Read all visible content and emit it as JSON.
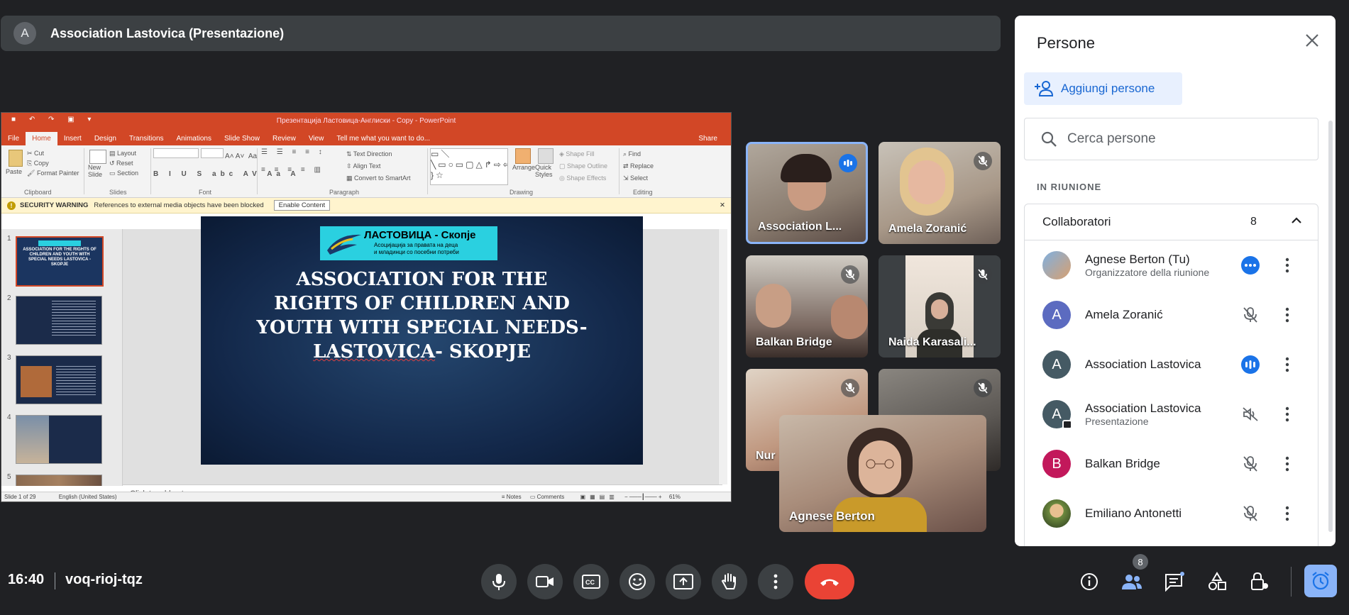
{
  "presenter_bar": {
    "avatar": "A",
    "title": "Association Lastovica (Presentazione)"
  },
  "ppt": {
    "window_title": "Презентација Ластовица-Англиски - Copy - PowerPoint",
    "tabs": [
      "File",
      "Home",
      "Insert",
      "Design",
      "Transitions",
      "Animations",
      "Slide Show",
      "Review",
      "View",
      "Tell me what you want to do..."
    ],
    "share": "Share",
    "ribbon": {
      "paste": "Paste",
      "cut": "Cut",
      "copy": "Copy",
      "format_painter": "Format Painter",
      "clipboard": "Clipboard",
      "new_slide": "New Slide",
      "layout": "Layout",
      "reset": "Reset",
      "section": "Section",
      "slides": "Slides",
      "font": "Font",
      "text_direction": "Text Direction",
      "align_text": "Align Text",
      "convert_smartart": "Convert to SmartArt",
      "paragraph": "Paragraph",
      "arrange": "Arrange",
      "quick_styles": "Quick Styles",
      "shape_fill": "Shape Fill",
      "shape_outline": "Shape Outline",
      "shape_effects": "Shape Effects",
      "drawing": "Drawing",
      "find": "Find",
      "replace": "Replace",
      "select": "Select",
      "editing": "Editing"
    },
    "warning": {
      "label": "SECURITY WARNING",
      "text": "References to external media objects have been blocked",
      "button": "Enable Content"
    },
    "thumbnail_numbers": [
      "1",
      "2",
      "3",
      "4",
      "5"
    ],
    "thumb1_title": "ASSOCIATION FOR THE RIGHTS OF CHILDREN AND YOUTH WITH SPECIAL NEEDS LASTOVICA - SKOPJE",
    "slide": {
      "logo_title": "ЛАСТОВИЦА - Скопје",
      "logo_sub1": "Асоцијација за правата на деца",
      "logo_sub2": "и младинци со посебни потреби",
      "title_l1": "ASSOCIATION FOR THE",
      "title_l2": "RIGHTS OF CHILDREN AND",
      "title_l3": "YOUTH WITH SPECIAL NEEDS-",
      "title_l4a": "LASTOVICA",
      "title_l4b": "- SKOPJE"
    },
    "notes_placeholder": "Click to add notes",
    "status": {
      "slide": "Slide 1 of 29",
      "lang": "English (United States)",
      "notes": "Notes",
      "comments": "Comments",
      "zoom": "61%"
    }
  },
  "tiles": [
    {
      "name": "Association L..."
    },
    {
      "name": "Amela Zoranić"
    },
    {
      "name": "Balkan Bridge"
    },
    {
      "name": "Naida Karasali..."
    },
    {
      "name": "Nur"
    },
    {
      "name": "Agnese Berton"
    }
  ],
  "panel": {
    "title": "Persone",
    "add_people": "Aggiungi persone",
    "search_placeholder": "Cerca persone",
    "in_meeting": "IN RIUNIONE",
    "collaborators": "Collaboratori",
    "count": "8",
    "people": [
      {
        "avatar": "",
        "name": "Agnese Berton (Tu)",
        "sub": "Organizzatore della riunione",
        "color": "#8ab4f8"
      },
      {
        "avatar": "A",
        "name": "Amela Zoranić",
        "sub": "",
        "color": "#5c6bc0"
      },
      {
        "avatar": "A",
        "name": "Association Lastovica",
        "sub": "",
        "color": "#455a64"
      },
      {
        "avatar": "A",
        "name": "Association Lastovica",
        "sub": "Presentazione",
        "color": "#455a64"
      },
      {
        "avatar": "B",
        "name": "Balkan Bridge",
        "sub": "",
        "color": "#c2185b"
      },
      {
        "avatar": "",
        "name": "Emiliano Antonetti",
        "sub": "",
        "color": "#6d8a3e"
      }
    ]
  },
  "bottom": {
    "time": "16:40",
    "code": "voq-rioj-tqz",
    "people_badge": "8"
  }
}
